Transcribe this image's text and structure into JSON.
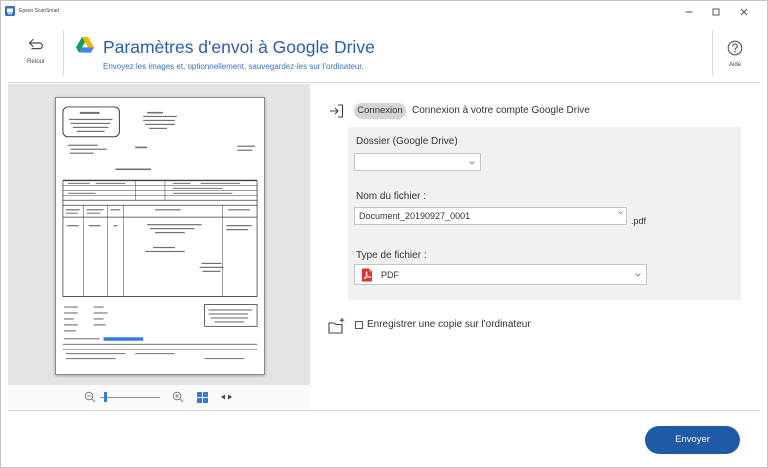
{
  "window": {
    "title": "Epson ScanSmart"
  },
  "header": {
    "back_label": "Retour",
    "title": "Paramètres d'envoi à Google Drive",
    "subtitle": "Envoyez les images et, optionnellement, sauvegardez-les sur l'ordinateur.",
    "help_label": "Aide"
  },
  "preview": {
    "zoom_fraction": 0.07
  },
  "account": {
    "connect_button": "Connexion",
    "connect_text": "Connexion à votre compte Google Drive"
  },
  "form": {
    "folder_label": "Dossier (Google Drive)",
    "folder_value": "",
    "filename_label": "Nom du fichier :",
    "filename_value": "Document_20190927_0001",
    "extension": ".pdf",
    "filetype_label": "Type de fichier :",
    "filetype_value": "PDF"
  },
  "save_copy": {
    "label": "Enregistrer une copie sur l'ordinateur",
    "checked": false
  },
  "footer": {
    "send_button": "Envoyer"
  },
  "icons": [
    "app-logo-icon",
    "minimize-icon",
    "maximize-icon",
    "close-icon",
    "back-arrow-icon",
    "google-drive-icon",
    "help-icon",
    "zoom-out-icon",
    "zoom-in-icon",
    "fit-page-icon",
    "fit-width-icon",
    "sign-in-icon",
    "chevron-down-icon",
    "pdf-file-icon",
    "folder-add-icon"
  ],
  "colors": {
    "title": "#2a5db0",
    "subtitle": "#3d6fc4",
    "accent": "#1f5aa6",
    "preview": "#e4e4e4",
    "panel": "#f1f1f1"
  }
}
